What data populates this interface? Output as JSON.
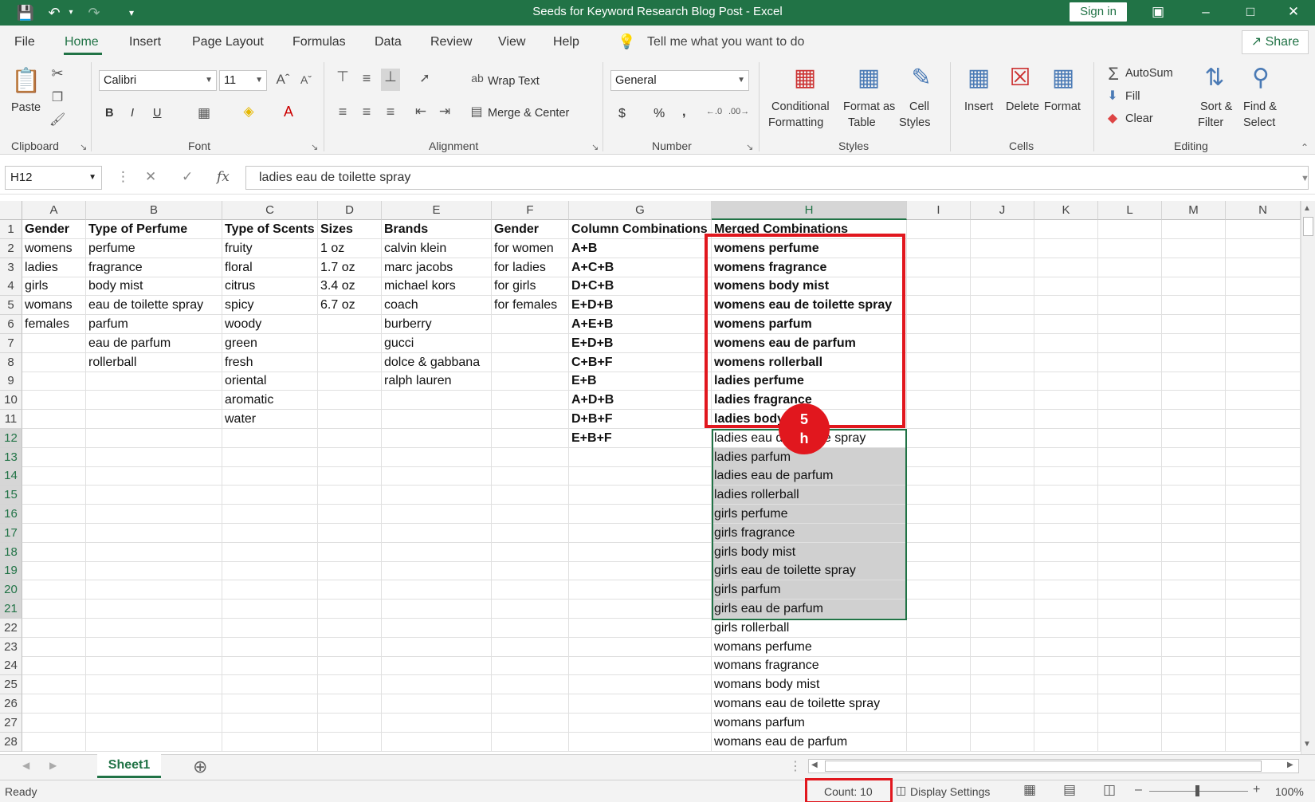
{
  "window": {
    "title": "Seeds for Keyword Research Blog Post  -  Excel",
    "sign_in": "Sign in"
  },
  "tabs": [
    "File",
    "Home",
    "Insert",
    "Page Layout",
    "Formulas",
    "Data",
    "Review",
    "View",
    "Help"
  ],
  "tell_me": "Tell me what you want to do",
  "share": "Share",
  "ribbon": {
    "clipboard": {
      "paste": "Paste",
      "group": "Clipboard"
    },
    "font": {
      "name": "Calibri",
      "size": "11",
      "bold": "B",
      "italic": "I",
      "underline": "U",
      "group": "Font"
    },
    "alignment": {
      "wrap": "Wrap Text",
      "merge": "Merge & Center",
      "group": "Alignment"
    },
    "number": {
      "format": "General",
      "currency": "$",
      "percent": "%",
      "comma": ",",
      "group": "Number"
    },
    "styles": {
      "conditional_1": "Conditional",
      "conditional_2": "Formatting",
      "format_table_1": "Format as",
      "format_table_2": "Table",
      "cell_styles_1": "Cell",
      "cell_styles_2": "Styles",
      "group": "Styles"
    },
    "cells": {
      "insert": "Insert",
      "delete": "Delete",
      "format": "Format",
      "group": "Cells"
    },
    "editing": {
      "autosum": "AutoSum",
      "fill": "Fill",
      "clear": "Clear",
      "sort_1": "Sort &",
      "sort_2": "Filter",
      "find_1": "Find &",
      "find_2": "Select",
      "group": "Editing"
    }
  },
  "formula_bar": {
    "name_box": "H12",
    "fx": "fx",
    "value": "ladies eau de toilette spray"
  },
  "columns": [
    "A",
    "B",
    "C",
    "D",
    "E",
    "F",
    "G",
    "H",
    "I",
    "J",
    "K",
    "L",
    "M",
    "N"
  ],
  "rows": [
    [
      "Gender",
      "Type of Perfume",
      "Type of Scents",
      "Sizes",
      "Brands",
      "Gender",
      "Column Combinations",
      "Merged Combinations"
    ],
    [
      "womens",
      "perfume",
      "fruity",
      "1 oz",
      "calvin klein",
      "for women",
      "A+B",
      "womens perfume"
    ],
    [
      "ladies",
      "fragrance",
      "floral",
      "1.7 oz",
      "marc jacobs",
      "for ladies",
      "A+C+B",
      "womens fragrance"
    ],
    [
      "girls",
      "body mist",
      "citrus",
      "3.4 oz",
      "michael kors",
      "for girls",
      "D+C+B",
      "womens body mist"
    ],
    [
      "womans",
      "eau de toilette spray",
      "spicy",
      "6.7 oz",
      "coach",
      "for females",
      "E+D+B",
      "womens eau de toilette spray"
    ],
    [
      "females",
      "parfum",
      "woody",
      "",
      "burberry",
      "",
      "A+E+B",
      "womens parfum"
    ],
    [
      "",
      "eau de parfum",
      "green",
      "",
      "gucci",
      "",
      "E+D+B",
      "womens eau de parfum"
    ],
    [
      "",
      "rollerball",
      "fresh",
      "",
      "dolce & gabbana",
      "",
      "C+B+F",
      "womens rollerball"
    ],
    [
      "",
      "",
      "oriental",
      "",
      "ralph lauren",
      "",
      "E+B",
      "ladies perfume"
    ],
    [
      "",
      "",
      "aromatic",
      "",
      "",
      "",
      "A+D+B",
      "ladies fragrance"
    ],
    [
      "",
      "",
      "water",
      "",
      "",
      "",
      "D+B+F",
      "ladies body mist"
    ],
    [
      "",
      "",
      "",
      "",
      "",
      "",
      "E+B+F",
      "ladies eau de toilette spray"
    ],
    [
      "",
      "",
      "",
      "",
      "",
      "",
      "",
      "ladies parfum"
    ],
    [
      "",
      "",
      "",
      "",
      "",
      "",
      "",
      "ladies eau de parfum"
    ],
    [
      "",
      "",
      "",
      "",
      "",
      "",
      "",
      "ladies rollerball"
    ],
    [
      "",
      "",
      "",
      "",
      "",
      "",
      "",
      "girls perfume"
    ],
    [
      "",
      "",
      "",
      "",
      "",
      "",
      "",
      "girls fragrance"
    ],
    [
      "",
      "",
      "",
      "",
      "",
      "",
      "",
      "girls body mist"
    ],
    [
      "",
      "",
      "",
      "",
      "",
      "",
      "",
      "girls eau de toilette spray"
    ],
    [
      "",
      "",
      "",
      "",
      "",
      "",
      "",
      "girls parfum"
    ],
    [
      "",
      "",
      "",
      "",
      "",
      "",
      "",
      "girls eau de parfum"
    ],
    [
      "",
      "",
      "",
      "",
      "",
      "",
      "",
      "girls rollerball"
    ],
    [
      "",
      "",
      "",
      "",
      "",
      "",
      "",
      "womans perfume"
    ],
    [
      "",
      "",
      "",
      "",
      "",
      "",
      "",
      "womans fragrance"
    ],
    [
      "",
      "",
      "",
      "",
      "",
      "",
      "",
      "womans body mist"
    ],
    [
      "",
      "",
      "",
      "",
      "",
      "",
      "",
      "womans eau de toilette spray"
    ],
    [
      "",
      "",
      "",
      "",
      "",
      "",
      "",
      "womans parfum"
    ],
    [
      "",
      "",
      "",
      "",
      "",
      "",
      "",
      "womans eau de parfum"
    ]
  ],
  "annotation": {
    "step": "5",
    "letter": "h"
  },
  "sheet_tab": "Sheet1",
  "status": {
    "ready": "Ready",
    "count": "Count: 10",
    "display_settings": "Display Settings",
    "zoom": "100%"
  },
  "colors": {
    "accent": "#217346",
    "highlight": "#e1171e",
    "selection_fill": "#d0d0d0"
  }
}
